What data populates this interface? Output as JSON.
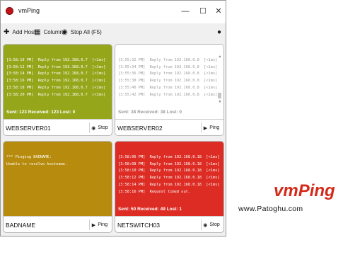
{
  "app": {
    "title": "vmPing"
  },
  "toolbar": {
    "add_host": "Add Host",
    "columns": "Columns",
    "stop_all": "Stop All (F5)"
  },
  "colors": {
    "green": "#95a61a",
    "gold": "#b78b0d",
    "red": "#dc2c24",
    "title_blue": "#243c8c",
    "stats_gray": "#9b9b9b"
  },
  "panels": [
    {
      "host": "WEBSERVER01",
      "button": "Stop",
      "button_icon": "stop-icon",
      "state": "up",
      "log": [
        "[3:58:10 PM]  Reply from 192.168.0.7  [<1ms]",
        "[3:58:12 PM]  Reply from 192.168.0.7  [<1ms]",
        "[3:58:14 PM]  Reply from 192.168.0.7  [<1ms]",
        "[3:58:16 PM]  Reply from 192.168.0.7  [<1ms]",
        "[3:58:18 PM]  Reply from 192.168.0.7  [<1ms]",
        "[3:58:20 PM]  Reply from 192.168.0.7  [<1ms]"
      ],
      "stats": "Sent: 123 Received: 123 Lost: 0"
    },
    {
      "host": "WEBSERVER02",
      "button": "Ping",
      "button_icon": "play-icon",
      "state": "inactive",
      "log": [
        "[3:55:32 PM]  Reply from 192.168.0.8  [<1ms]",
        "[3:55:34 PM]  Reply from 192.168.0.8  [<1ms]",
        "[3:55:36 PM]  Reply from 192.168.0.8  [<1ms]",
        "[3:55:38 PM]  Reply from 192.168.0.8  [<1ms]",
        "[3:55:40 PM]  Reply from 192.168.0.8  [<1ms]",
        "[3:55:42 PM]  Reply from 192.168.0.8  [<1ms]"
      ],
      "stats": "Sent: 38 Received: 38 Lost: 0"
    },
    {
      "host": "BADNAME",
      "button": "Ping",
      "button_icon": "play-icon",
      "state": "error",
      "log": [
        "*** Pinging BADNAME:",
        "Unable to resolve hostname."
      ],
      "stats": ""
    },
    {
      "host": "NETSWITCH03",
      "button": "Stop",
      "button_icon": "stop-icon",
      "state": "down",
      "log": [
        "[3:58:06 PM]  Reply from 192.168.0.18  [<1ms]",
        "[3:58:08 PM]  Reply from 192.168.0.18  [<1ms]",
        "[3:58:10 PM]  Reply from 192.168.0.18  [<1ms]",
        "[3:58:12 PM]  Reply from 192.168.0.18  [<1ms]",
        "[3:58:14 PM]  Reply from 192.168.0.18  [<1ms]",
        "[3:58:16 PM]  Request timed out."
      ],
      "stats": "Sent: 50 Received: 49 Lost: 1"
    }
  ],
  "brand": {
    "name": "vmPing",
    "site": "www.Patoghu.com"
  }
}
